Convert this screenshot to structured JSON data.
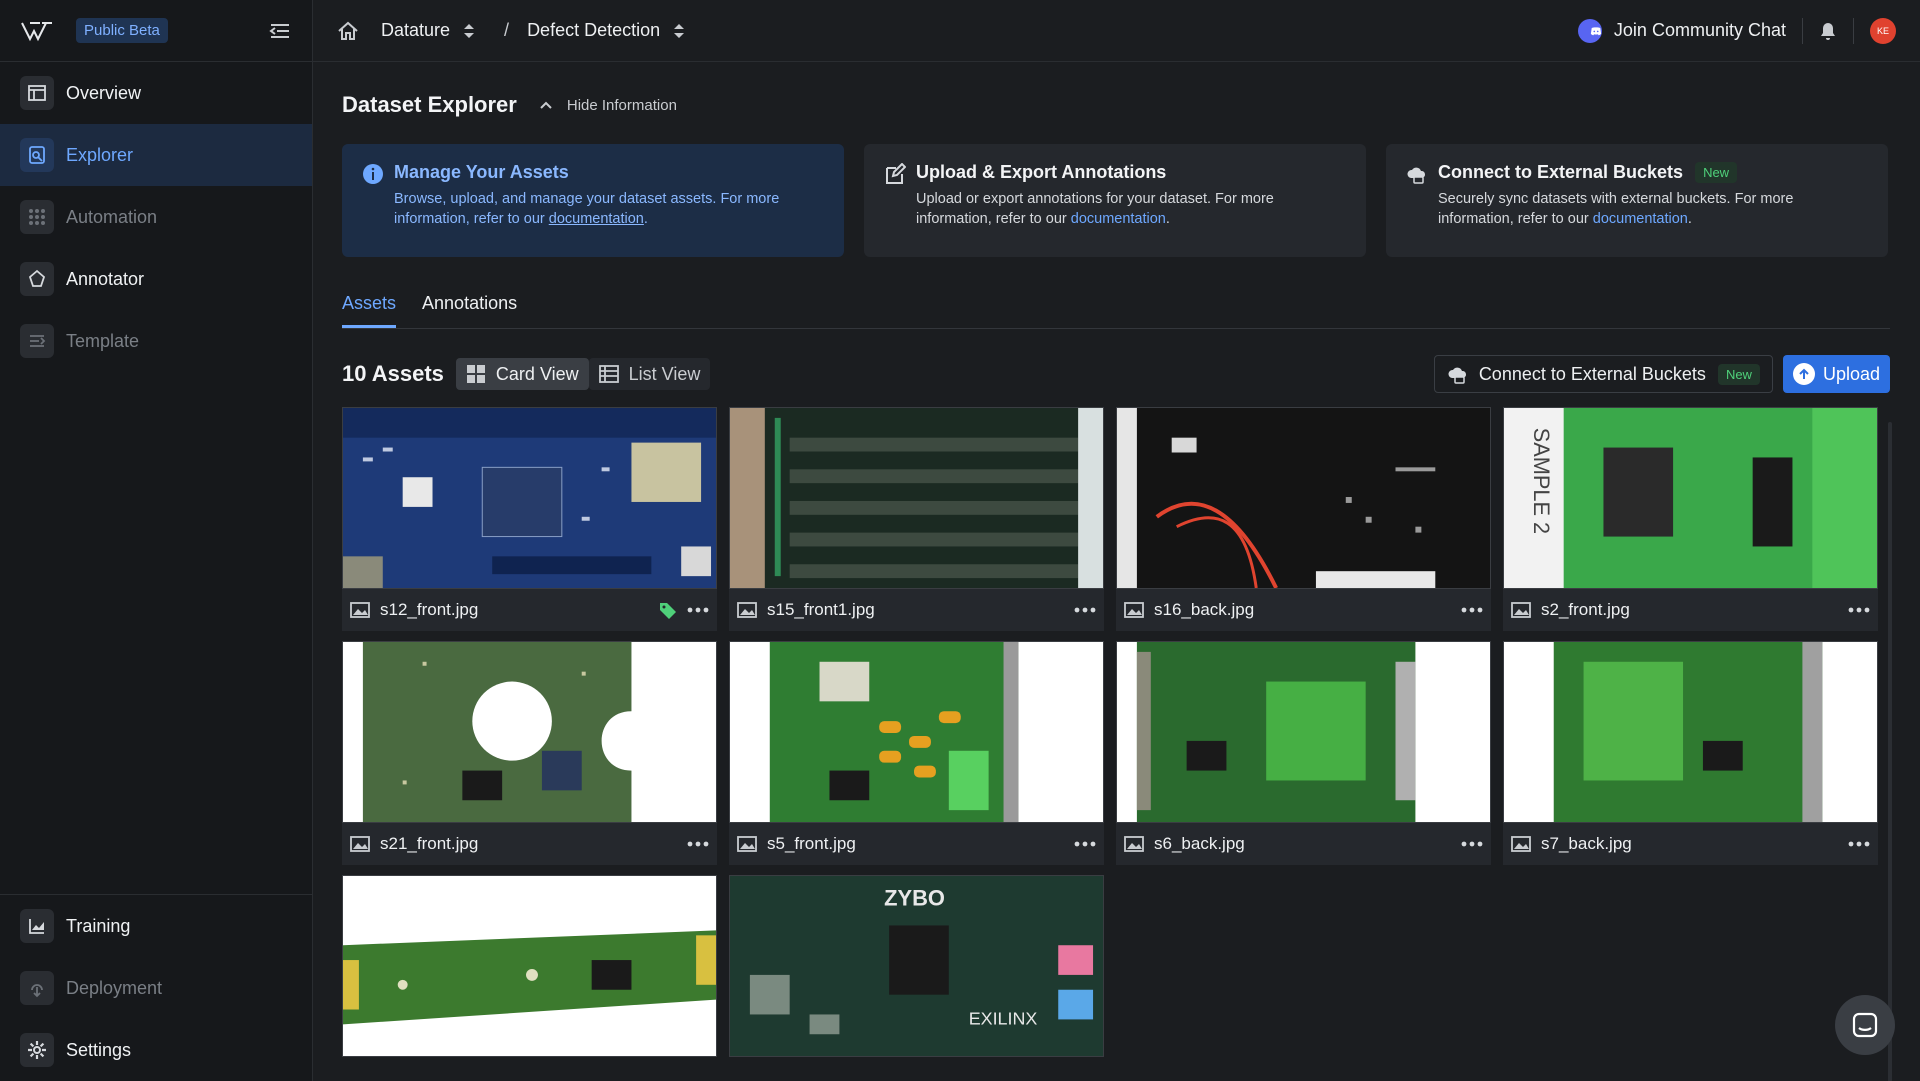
{
  "sidebar": {
    "beta_label": "Public Beta",
    "items": [
      {
        "label": "Overview",
        "icon": "overview-icon"
      },
      {
        "label": "Explorer",
        "icon": "explorer-icon"
      },
      {
        "label": "Automation",
        "icon": "automation-icon"
      },
      {
        "label": "Annotator",
        "icon": "annotator-icon"
      },
      {
        "label": "Template",
        "icon": "template-icon"
      }
    ],
    "bottom_items": [
      {
        "label": "Training",
        "icon": "training-icon"
      },
      {
        "label": "Deployment",
        "icon": "deployment-icon"
      },
      {
        "label": "Settings",
        "icon": "settings-icon"
      }
    ]
  },
  "header": {
    "breadcrumb": [
      "Datature",
      "Defect Detection"
    ],
    "separator": "/",
    "community": "Join Community Chat",
    "avatar_initials": "KE"
  },
  "main": {
    "title": "Dataset Explorer",
    "hide_info": "Hide Information",
    "info_cards": [
      {
        "title": "Manage Your Assets",
        "body": "Browse, upload, and manage your dataset assets. For more information, refer to our ",
        "link": "documentation",
        "suffix": "."
      },
      {
        "title": "Upload & Export Annotations",
        "body": "Upload or export annotations for your dataset. For more information, refer to our ",
        "link": "documentation",
        "suffix": "."
      },
      {
        "title": "Connect to External Buckets",
        "badge": "New",
        "body": "Securely sync datasets with external buckets. For more information, refer to our ",
        "link": "documentation",
        "suffix": "."
      }
    ],
    "tabs": [
      "Assets",
      "Annotations"
    ],
    "asset_count": "10 Assets",
    "views": [
      "Card View",
      "List View"
    ],
    "external_button": "Connect to External Buckets",
    "external_badge": "New",
    "upload_button": "Upload",
    "assets": [
      {
        "name": "s12_front.jpg",
        "tagged": true
      },
      {
        "name": "s15_front1.jpg",
        "tagged": false
      },
      {
        "name": "s16_back.jpg",
        "tagged": false
      },
      {
        "name": "s2_front.jpg",
        "tagged": false
      },
      {
        "name": "s21_front.jpg",
        "tagged": false
      },
      {
        "name": "s5_front.jpg",
        "tagged": false
      },
      {
        "name": "s6_back.jpg",
        "tagged": false
      },
      {
        "name": "s7_back.jpg",
        "tagged": false
      },
      {
        "name": "",
        "tagged": false
      },
      {
        "name": "",
        "tagged": false
      }
    ],
    "thumb_text": {
      "sample": "SAMPLE 2",
      "zybo": "ZYBO",
      "xilinx": "EXILINX"
    }
  },
  "colors": {
    "accent": "#2d6fe0",
    "link": "#6ea8ff",
    "new_badge": "#4fd07a",
    "avatar": "#e0422f"
  }
}
